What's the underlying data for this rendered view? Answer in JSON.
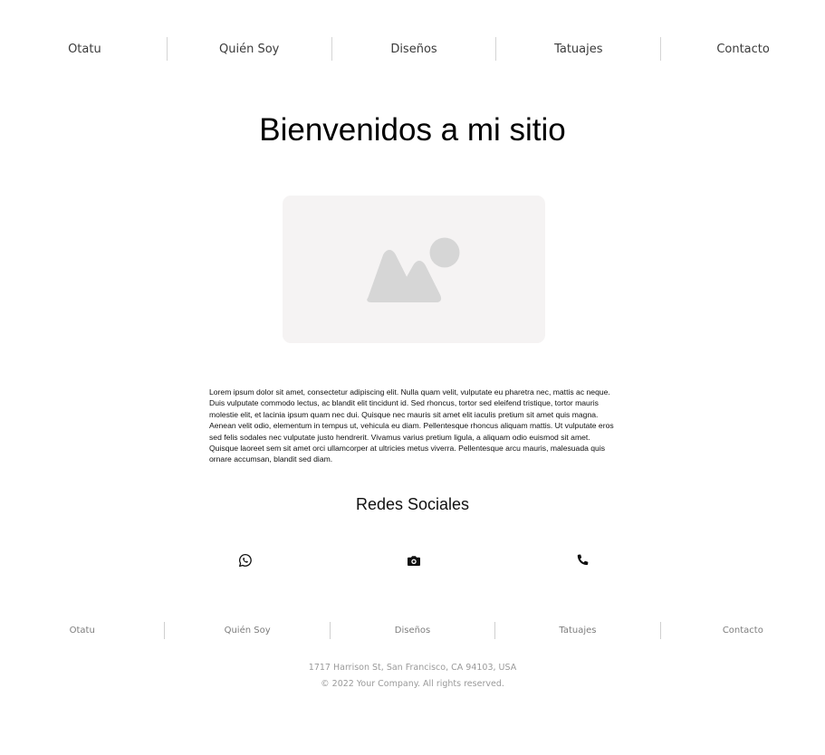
{
  "nav": {
    "items": [
      {
        "label": "Otatu"
      },
      {
        "label": "Quién Soy"
      },
      {
        "label": "Diseños"
      },
      {
        "label": "Tatuajes"
      },
      {
        "label": "Contacto"
      }
    ]
  },
  "hero": {
    "title": "Bienvenidos a mi sitio",
    "image_icon": "image-placeholder-icon"
  },
  "content": {
    "paragraph": "Lorem ipsum dolor sit amet, consectetur adipiscing elit. Nulla quam velit, vulputate eu pharetra nec, mattis ac neque. Duis vulputate commodo lectus, ac blandit elit tincidunt id. Sed rhoncus, tortor sed eleifend tristique, tortor mauris molestie elit, et lacinia ipsum quam nec dui. Quisque nec mauris sit amet elit iaculis pretium sit amet quis magna. Aenean velit odio, elementum in tempus ut, vehicula eu diam. Pellentesque rhoncus aliquam mattis. Ut vulputate eros sed felis sodales nec vulputate justo hendrerit. Vivamus varius pretium ligula, a aliquam odio euismod sit amet. Quisque laoreet sem sit amet orci ullamcorper at ultricies metus viverra. Pellentesque arcu mauris, malesuada quis ornare accumsan, blandit sed diam."
  },
  "social": {
    "title": "Redes Sociales",
    "icons": [
      "whatsapp-icon",
      "camera-icon",
      "phone-icon"
    ]
  },
  "footer": {
    "nav": [
      {
        "label": "Otatu"
      },
      {
        "label": "Quién Soy"
      },
      {
        "label": "Diseños"
      },
      {
        "label": "Tatuajes"
      },
      {
        "label": "Contacto"
      }
    ],
    "address": "1717 Harrison St, San Francisco, CA 94103, USA",
    "copyright": "© 2022 Your Company.  All rights reserved."
  },
  "colors": {
    "nav_text": "#3b3b3b",
    "footer_text": "#9a9a9a",
    "placeholder_bg": "#f5f3f3",
    "placeholder_icon": "#d6d6d6"
  }
}
